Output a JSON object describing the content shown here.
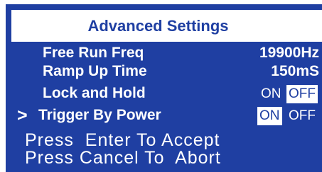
{
  "title": "Advanced Settings",
  "cursor": ">",
  "settings": [
    {
      "label": "Free Run Freq",
      "value": "19900Hz"
    },
    {
      "label": "Ramp Up Time",
      "value": "150mS"
    },
    {
      "label": "Lock and Hold",
      "on": "ON",
      "off": "OFF",
      "selected": "OFF"
    },
    {
      "label": "Trigger By Power",
      "on": "ON",
      "off": "OFF",
      "selected": "ON"
    }
  ],
  "messages": [
    "Press  Enter To Accept",
    "Press Cancel To  Abort"
  ],
  "colors": {
    "background": "#1f3fa2",
    "foreground": "#ffffff"
  }
}
